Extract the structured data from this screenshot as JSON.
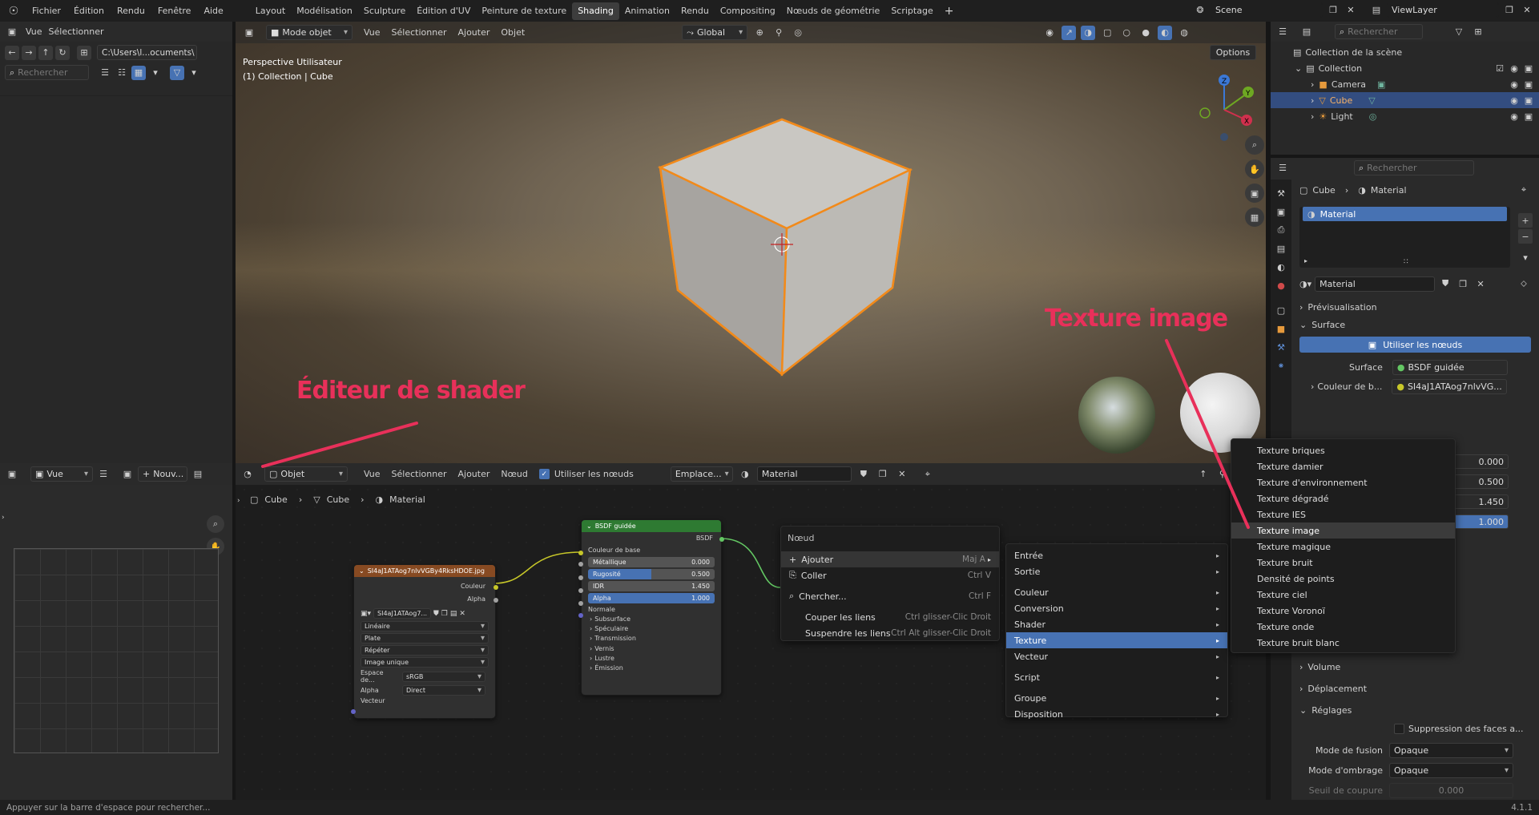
{
  "topbar": {
    "menus": [
      "Fichier",
      "Édition",
      "Rendu",
      "Fenêtre",
      "Aide"
    ],
    "workspaces": [
      "Layout",
      "Modélisation",
      "Sculpture",
      "Édition d'UV",
      "Peinture de texture",
      "Shading",
      "Animation",
      "Rendu",
      "Compositing",
      "Nœuds de géométrie",
      "Scriptage"
    ],
    "active_workspace": "Shading",
    "scene": "Scene",
    "viewlayer": "ViewLayer"
  },
  "filebrowser": {
    "menus": [
      "Vue",
      "Sélectionner"
    ],
    "path": "C:\\Users\\l...ocuments\\",
    "search_placeholder": "Rechercher"
  },
  "viewport": {
    "mode": "Mode objet",
    "menus": [
      "Vue",
      "Sélectionner",
      "Ajouter",
      "Objet"
    ],
    "orientation": "Global",
    "options": "Options",
    "title": "Perspective Utilisateur",
    "subtitle": "(1) Collection | Cube"
  },
  "outliner": {
    "search_placeholder": "Rechercher",
    "items": [
      "Collection de la scène",
      "Collection",
      "Camera",
      "Cube",
      "Light"
    ]
  },
  "properties": {
    "search_placeholder": "Rechercher",
    "breadcrumb": [
      "Cube",
      "Material"
    ],
    "slot": "Material",
    "material_name": "Material",
    "sections": {
      "preview": "Prévisualisation",
      "surface": "Surface",
      "volume": "Volume",
      "displacement": "Déplacement",
      "settings": "Réglages"
    },
    "use_nodes": "Utiliser les nœuds",
    "surface_label": "Surface",
    "surface_value": "BSDF guidée",
    "base_color_label": "Couleur de b...",
    "base_color_value": "SI4aJ1ATAog7nlvVG...",
    "values": [
      "0.000",
      "0.500",
      "1.450",
      "1.000"
    ],
    "backface": "Suppression des faces a...",
    "blend_label": "Mode de fusion",
    "blend_value": "Opaque",
    "shadow_label": "Mode d'ombrage",
    "shadow_value": "Opaque",
    "clip_label": "Seuil de coupure",
    "clip_value": "0.000"
  },
  "imageeditor": {
    "view": "Vue",
    "new": "Nouv..."
  },
  "shader": {
    "object": "Objet",
    "menus": [
      "Vue",
      "Sélectionner",
      "Ajouter",
      "Nœud"
    ],
    "use_nodes": "Utiliser les nœuds",
    "slot": "Emplace...",
    "material": "Material",
    "breadcrumb": [
      "Cube",
      "Cube",
      "Material"
    ]
  },
  "bsdf": {
    "title": "BSDF guidée",
    "output": "BSDF",
    "base_color": "Couleur de base",
    "metallic": "Métallique",
    "metallic_v": "0.000",
    "roughness": "Rugosité",
    "roughness_v": "0.500",
    "ior": "IDR",
    "ior_v": "1.450",
    "alpha": "Alpha",
    "alpha_v": "1.000",
    "normal": "Normale",
    "subs": [
      "Subsurface",
      "Spéculaire",
      "Transmission",
      "Vernis",
      "Lustre",
      "Émission"
    ]
  },
  "imgnode": {
    "title": "SI4aJ1ATAog7nlvVGBy4RksHDOE.jpg",
    "out_color": "Couleur",
    "out_alpha": "Alpha",
    "image": "SI4aJ1ATAog7...",
    "interp": "Linéaire",
    "proj": "Plate",
    "ext": "Répéter",
    "source": "Image unique",
    "cs_label": "Espace de...",
    "cs_value": "sRGB",
    "alpha_label": "Alpha",
    "alpha_value": "Direct",
    "vector": "Vecteur"
  },
  "menu_node": {
    "title": "Nœud",
    "items": [
      {
        "label": "Ajouter",
        "shortcut": "Maj A"
      },
      {
        "label": "Coller",
        "shortcut": "Ctrl V"
      },
      {
        "label": "Chercher...",
        "shortcut": "Ctrl F"
      },
      {
        "label": "Couper les liens",
        "shortcut": "Ctrl glisser-Clic Droit"
      },
      {
        "label": "Suspendre les liens",
        "shortcut": "Ctrl Alt glisser-Clic Droit"
      }
    ]
  },
  "menu_add": {
    "items": [
      "Entrée",
      "Sortie",
      "Couleur",
      "Conversion",
      "Shader",
      "Texture",
      "Vecteur",
      "Script",
      "Groupe",
      "Disposition"
    ]
  },
  "menu_texture": {
    "items": [
      "Texture briques",
      "Texture damier",
      "Texture d'environnement",
      "Texture dégradé",
      "Texture IES",
      "Texture image",
      "Texture magique",
      "Texture bruit",
      "Densité de points",
      "Texture ciel",
      "Texture Voronoï",
      "Texture onde",
      "Texture bruit blanc"
    ],
    "highlight": "Texture image"
  },
  "annotations": {
    "shader_editor": "Éditeur de shader",
    "texture_image": "Texture image"
  },
  "statusbar": {
    "hint": "Appuyer sur la barre d'espace pour rechercher...",
    "version": "4.1.1"
  },
  "colors": {
    "accent": "#4772b3",
    "annotation": "#e8305a",
    "selected_outline": "#f28a1a"
  }
}
